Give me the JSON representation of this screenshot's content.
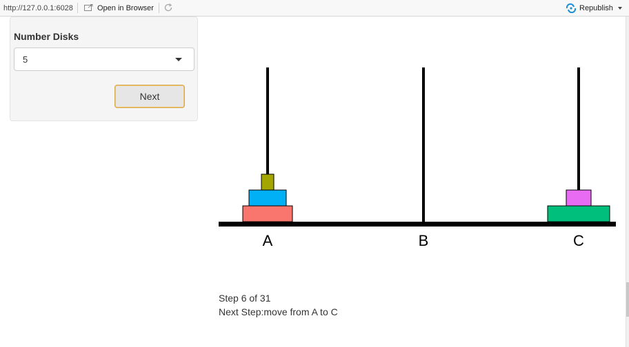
{
  "toolbar": {
    "url": "http://127.0.0.1:6028",
    "open_in_browser_label": "Open in Browser",
    "republish_label": "Republish",
    "icons": [
      "open-in-browser-icon",
      "refresh-icon",
      "republish-icon"
    ]
  },
  "sidebar": {
    "number_disks_label": "Number Disks",
    "number_disks_value": "5",
    "next_button_label": "Next"
  },
  "status": {
    "step_text": "Step 6 of 31",
    "next_step_text": "Next Step:move from A to C"
  },
  "hanoi": {
    "pegs": [
      "A",
      "B",
      "C"
    ],
    "disks": [
      {
        "size": 1,
        "peg": "A",
        "level": 2,
        "color": "#a3a500"
      },
      {
        "size": 3,
        "peg": "A",
        "level": 1,
        "color": "#00b0f6"
      },
      {
        "size": 4,
        "peg": "A",
        "level": 0,
        "color": "#f8766d"
      },
      {
        "size": 2,
        "peg": "C",
        "level": 1,
        "color": "#e76bf3"
      },
      {
        "size": 5,
        "peg": "C",
        "level": 0,
        "color": "#00bf7d"
      }
    ]
  }
}
